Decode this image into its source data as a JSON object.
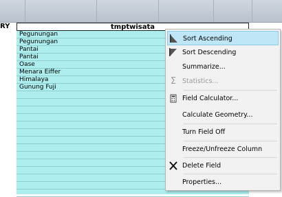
{
  "table": {
    "left_header": "RY",
    "column_header": "tmptwisata",
    "rows": [
      "Pegunungan",
      "Pegunungan",
      "Pantai",
      "Pantai",
      "Oase",
      "Menara Eiffer",
      "Himalaya",
      "Gunung Fuji",
      "",
      "",
      "",
      "",
      "",
      "",
      "",
      "",
      "",
      "",
      "",
      "",
      "",
      ""
    ]
  },
  "context_menu": {
    "items": [
      {
        "label": "Sort Ascending",
        "icon": "sort-ascending-icon",
        "state": "hover"
      },
      {
        "label": "Sort Descending",
        "icon": "sort-descending-icon",
        "state": "enabled"
      },
      {
        "label": "Summarize...",
        "icon": "",
        "state": "enabled"
      },
      {
        "label": "Statistics...",
        "icon": "sigma-icon",
        "state": "disabled"
      },
      {
        "label": "Field Calculator...",
        "icon": "calculator-icon",
        "state": "enabled"
      },
      {
        "label": "Calculate Geometry...",
        "icon": "",
        "state": "enabled"
      },
      {
        "label": "Turn Field Off",
        "icon": "",
        "state": "enabled"
      },
      {
        "label": "Freeze/Unfreeze Column",
        "icon": "",
        "state": "enabled"
      },
      {
        "label": "Delete Field",
        "icon": "delete-x-icon",
        "state": "enabled"
      },
      {
        "label": "Properties...",
        "icon": "",
        "state": "enabled"
      }
    ]
  },
  "colors": {
    "table_fill": "#aeeeee",
    "menu_hover": "#bfe6f6",
    "menu_background": "#f2f2f2"
  }
}
